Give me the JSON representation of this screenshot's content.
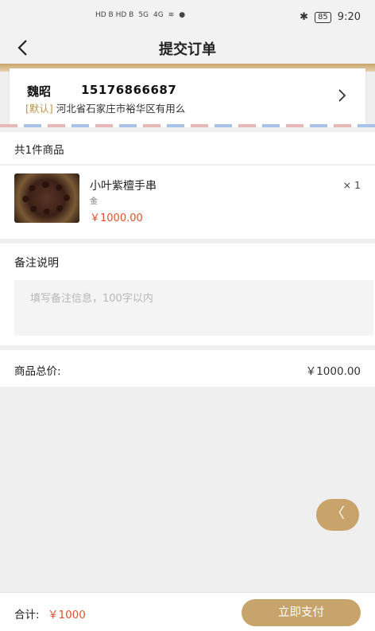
{
  "status_bar": {
    "network_left": "HD B HD B",
    "signal_1": "5G",
    "signal_2": "4G",
    "battery": "85",
    "time": "9:20"
  },
  "nav": {
    "title": "提交订单"
  },
  "address": {
    "name": "魏昭",
    "phone": "15176866687",
    "tag": "[默认]",
    "detail": "河北省石家庄市裕华区有用么"
  },
  "goods": {
    "count_label": "共1件商品",
    "items": [
      {
        "name": "小叶紫檀手串",
        "spec": "金",
        "price": "￥1000.00",
        "qty": "× 1"
      }
    ]
  },
  "remark": {
    "title": "备注说明",
    "placeholder": "填写备注信息，100字以内"
  },
  "summary": {
    "total_label": "商品总价:",
    "total_value": "￥1000.00"
  },
  "float_button": {
    "glyph": "〈"
  },
  "bottom": {
    "sum_label": "合计:",
    "sum_value": "￥1000",
    "pay_label": "立即支付"
  },
  "colors": {
    "accent_gold": "#c7a46b",
    "price_red": "#e0522c"
  }
}
